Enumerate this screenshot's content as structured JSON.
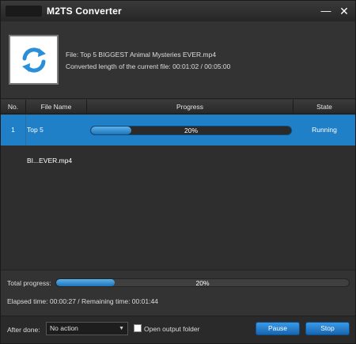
{
  "window": {
    "title": "M2TS Converter"
  },
  "info": {
    "file_line": "File: Top 5 BIGGEST Animal Mysteries EVER.mp4",
    "length_line": "Converted length of the current file: 00:01:02 / 00:05:00",
    "thumbnail_icon": "refresh-icon"
  },
  "table": {
    "headers": [
      "No.",
      "File Name",
      "Progress",
      "State"
    ],
    "rows": [
      {
        "no": "1",
        "file_name": "Top 5 BI...EVER.mp4",
        "progress_text": "20%",
        "progress_value": 0.2,
        "state": "Running"
      }
    ]
  },
  "total": {
    "label": "Total progress:",
    "progress_text": "20%",
    "progress_value": 0.2,
    "elapsed_line": "Elapsed time: 00:00:27 / Remaining time: 00:01:44"
  },
  "footer": {
    "after_done_label": "After done:",
    "after_done_value": "No action",
    "open_folder_label": "Open output folder",
    "open_folder_checked": false,
    "pause_label": "Pause",
    "stop_label": "Stop"
  },
  "colors": {
    "accent": "#1f7fc7",
    "progress": "#4aa3e3",
    "background": "#2e2e2e"
  }
}
